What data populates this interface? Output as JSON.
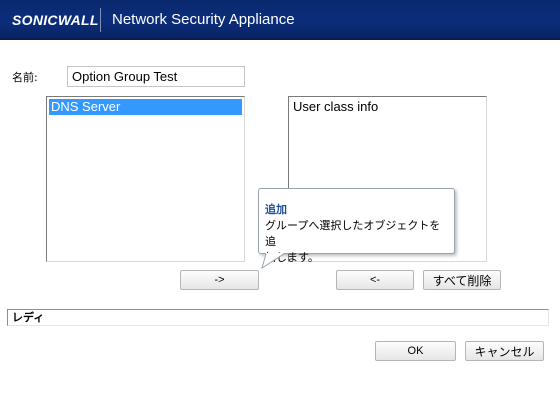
{
  "header": {
    "logo_text": "SONICWALL",
    "app_title": "Network Security Appliance",
    "background_color": "#0b2d7a"
  },
  "form": {
    "name_label": "名前:",
    "name_value": "Option Group Test"
  },
  "available_list": {
    "items": [
      {
        "label": "DNS Server",
        "selected": true
      }
    ]
  },
  "selected_list": {
    "items": [
      {
        "label": "User class info",
        "selected": false
      }
    ]
  },
  "buttons": {
    "add": "->",
    "remove": "<-",
    "remove_all": "すべて削除",
    "ok": "OK",
    "cancel": "キャンセル"
  },
  "tooltip": {
    "title": "追加",
    "body_line1": "グループへ選択したオブジェクトを追",
    "body_line2": "加します。"
  },
  "status": {
    "text": "レディ"
  },
  "colors": {
    "selection": "#3399ff",
    "tooltip_title": "#1f4e99"
  }
}
